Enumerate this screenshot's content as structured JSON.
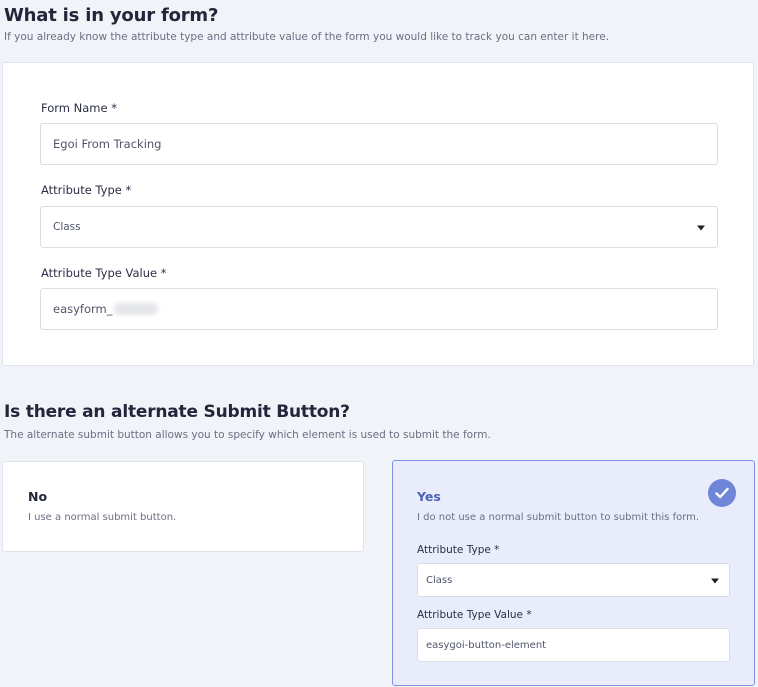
{
  "section1": {
    "title": "What is in your form?",
    "subtitle": "If you already know the attribute type and attribute value of the form you would like to track you can enter it here.",
    "form_name_label": "Form Name *",
    "form_name_value": "Egoi From Tracking",
    "attr_type_label": "Attribute Type *",
    "attr_type_value": "Class",
    "attr_value_label": "Attribute Type Value *",
    "attr_value_value": "easyform_"
  },
  "section2": {
    "title": "Is there an alternate Submit Button?",
    "subtitle": "The alternate submit button allows you to specify which element is used to submit the form.",
    "no_option": {
      "title": "No",
      "description": "I use a normal submit button."
    },
    "yes_option": {
      "title": "Yes",
      "description": "I do not use a normal submit button to submit this form.",
      "attr_type_label": "Attribute Type *",
      "attr_type_value": "Class",
      "attr_value_label": "Attribute Type Value *",
      "attr_value_value": "easygoi-button-element",
      "selected": true
    }
  },
  "colors": {
    "accent": "#6f85d8",
    "selected_bg": "#e9ecfb",
    "selected_border": "#7f93e6"
  },
  "icons": {
    "selected": "check-icon",
    "dropdown": "caret-down-icon"
  }
}
